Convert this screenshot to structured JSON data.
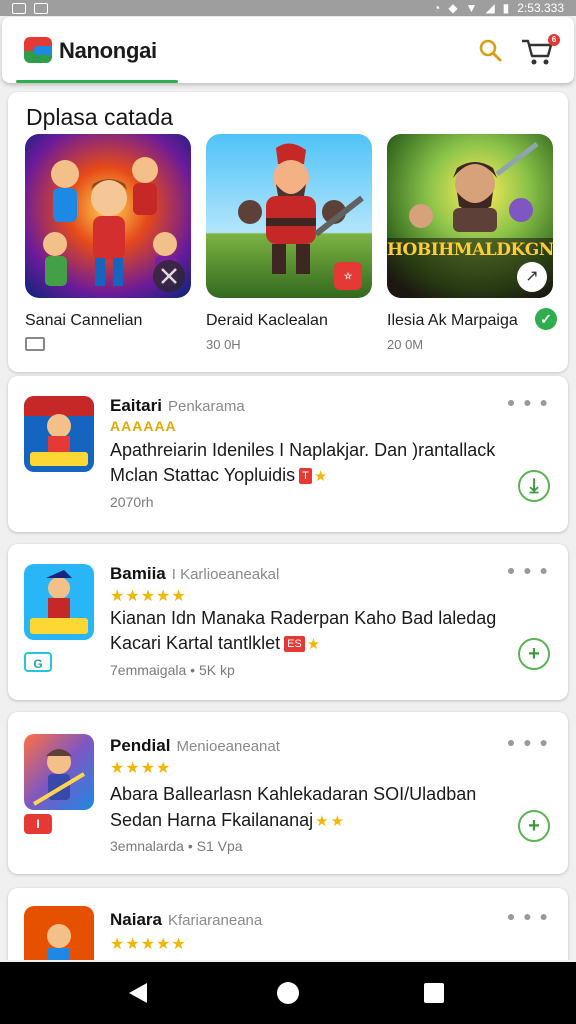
{
  "status_bar": {
    "time": "2:53.333",
    "left_icons": [
      "sim-icon",
      "image-icon"
    ],
    "right_icons": [
      "alarm-icon",
      "location-icon",
      "wifi-icon",
      "signal-icon",
      "battery-icon"
    ]
  },
  "app_bar": {
    "title": "Nanongai",
    "cart_count": "6",
    "colors": {
      "accent": "#2eae4f",
      "search": "#d4a017",
      "badge": "#e53935"
    }
  },
  "featured": {
    "title": "Dplasa catada",
    "items": [
      {
        "name": "Sanai Cannelian",
        "meta": "",
        "thumb": "heroes-group-art",
        "badge": "swords-icon"
      },
      {
        "name": "Deraid Kaclealan",
        "meta": "30 0H",
        "thumb": "warrior-art",
        "badge": "rating-badge"
      },
      {
        "name": "Ilesia Ak Marpaiga",
        "meta": "20 0M",
        "thumb": "boss-battle-art",
        "overlay_text": "HOBIHMALDKGN",
        "badge": "verified-icon"
      }
    ]
  },
  "app_list": [
    {
      "name": "Eaitari",
      "developer": "Penkarama",
      "rating_text": "AAAAAA",
      "desc_line1": "Apathreiarin Ideniles I Naplakjar. Dan )rantallack",
      "desc_line2": "Mclan Stattac Yopluidis",
      "inline_badge": "T",
      "meta": "2070rh",
      "side_badge": ""
    },
    {
      "name": "Bamiia",
      "developer": "I Karlioeaneakal",
      "rating_text": "★★★★★",
      "desc_line1": "Kianan Idn Manaka Raderpan Kaho Bad laledag",
      "desc_line2": "Kacari Kartal tantlklet",
      "inline_badge": "ES",
      "meta": "7emmaigala • 5K kp",
      "side_badge": "G"
    },
    {
      "name": "Pendial",
      "developer": "Menioeaneanat",
      "rating_text": "★★★★",
      "desc_line1": "Abara Ballearlasn Kahlekadaran SOI/Uladban",
      "desc_line2": "Sedan Harna Fkailananaj",
      "inline_badge": "",
      "meta": "3emnalarda • S1 Vpa",
      "side_badge": "I"
    },
    {
      "name": "Naiara",
      "developer": "Kfariaraneana",
      "rating_text": "★★★★★",
      "desc_line1": "",
      "desc_line2": "",
      "inline_badge": "",
      "meta": "",
      "side_badge": ""
    }
  ],
  "nav": {
    "buttons": [
      "back-icon",
      "home-icon",
      "recents-icon"
    ]
  }
}
